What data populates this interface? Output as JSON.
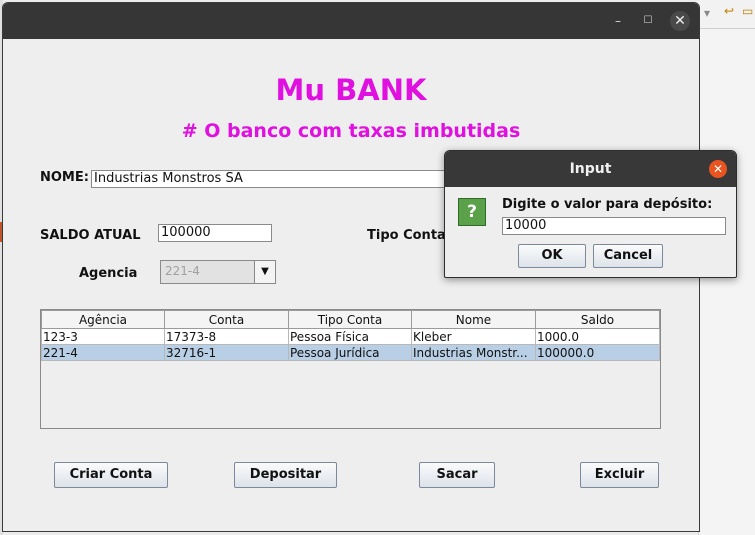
{
  "app": {
    "title": "Mu BANK",
    "subtitle": "# O banco com taxas imbutidas"
  },
  "window_controls": {
    "minimize": "–",
    "maximize": "☐",
    "close": "✕"
  },
  "form": {
    "nome_label": "NOME:",
    "nome_value": "Industrias Monstros SA",
    "saldo_label": "SALDO ATUAL",
    "saldo_value": "100000",
    "tipo_conta_label": "Tipo Conta",
    "agencia_label": "Agencia",
    "agencia_value": "221-4"
  },
  "table": {
    "columns": [
      "Agência",
      "Conta",
      "Tipo Conta",
      "Nome",
      "Saldo"
    ],
    "rows": [
      [
        "123-3",
        "17373-8",
        "Pessoa Física",
        "Kleber",
        "1000.0"
      ],
      [
        "221-4",
        "32716-1",
        "Pessoa Jurídica",
        "Industrias Monstr...",
        "100000.0"
      ]
    ],
    "selected_row": 1
  },
  "buttons": {
    "criar": "Criar Conta",
    "depositar": "Depositar",
    "sacar": "Sacar",
    "excluir": "Excluir"
  },
  "dialog": {
    "title": "Input",
    "message": "Digite o valor para depósito:",
    "input_value": "10000",
    "ok": "OK",
    "cancel": "Cancel",
    "icon": "question-icon",
    "icon_glyph": "?",
    "close_glyph": "✕"
  },
  "colors": {
    "title_magenta": "#e010e0",
    "selection": "#b8cfe5",
    "titlebar": "#363636",
    "close_orange": "#e95420"
  }
}
